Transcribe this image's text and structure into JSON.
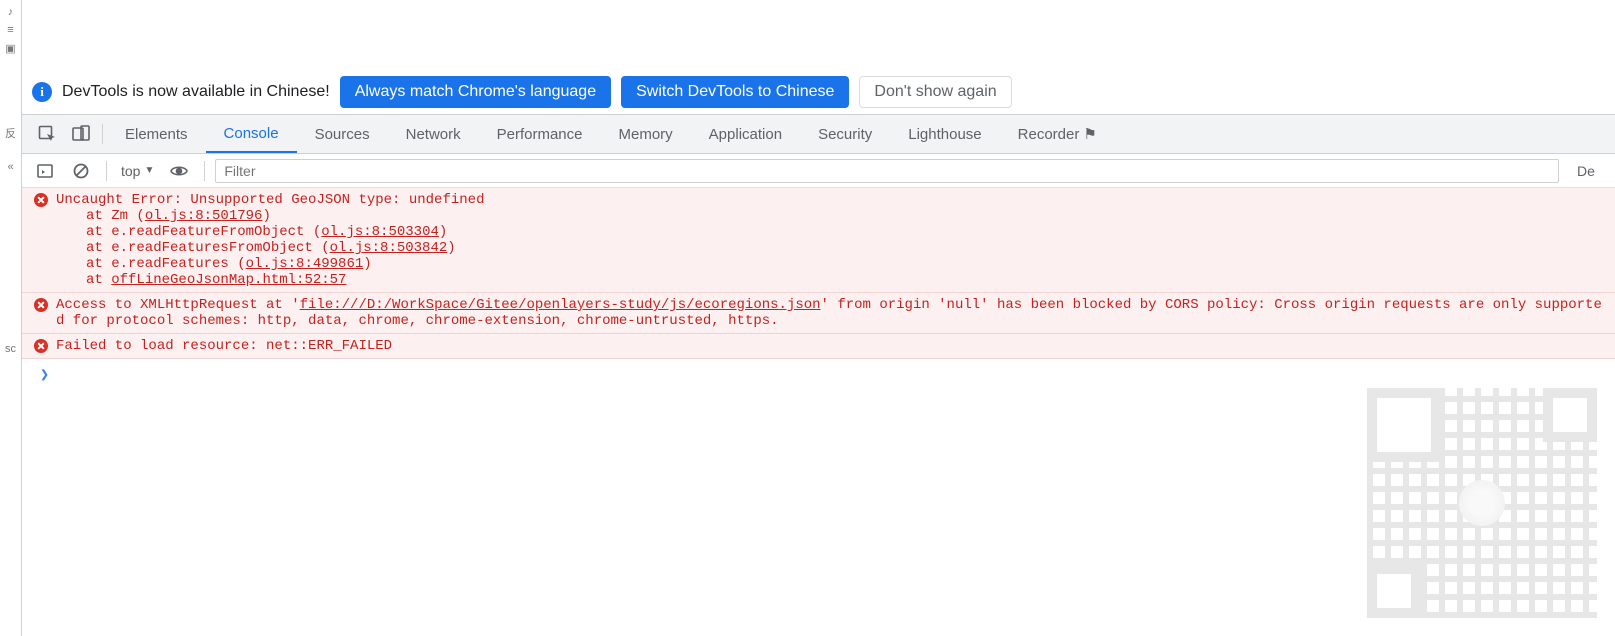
{
  "banner": {
    "text": "DevTools is now available in Chinese!",
    "always_button": "Always match Chrome's language",
    "switch_button": "Switch DevTools to Chinese",
    "dismiss_button": "Don't show again"
  },
  "tabs": {
    "items": [
      {
        "label": "Elements"
      },
      {
        "label": "Console"
      },
      {
        "label": "Sources"
      },
      {
        "label": "Network"
      },
      {
        "label": "Performance"
      },
      {
        "label": "Memory"
      },
      {
        "label": "Application"
      },
      {
        "label": "Security"
      },
      {
        "label": "Lighthouse"
      },
      {
        "label": "Recorder"
      }
    ],
    "active_index": 1
  },
  "toolbar": {
    "context_label": "top",
    "filter_placeholder": "Filter",
    "suffix_text": "De"
  },
  "console": {
    "messages": [
      {
        "type": "error",
        "text": "Uncaught Error: Unsupported GeoJSON type: undefined",
        "stack": [
          {
            "prefix": "at Zm (",
            "link": "ol.js:8:501796",
            "suffix": ")"
          },
          {
            "prefix": "at e.readFeatureFromObject (",
            "link": "ol.js:8:503304",
            "suffix": ")"
          },
          {
            "prefix": "at e.readFeaturesFromObject (",
            "link": "ol.js:8:503842",
            "suffix": ")"
          },
          {
            "prefix": "at e.readFeatures (",
            "link": "ol.js:8:499861",
            "suffix": ")"
          },
          {
            "prefix": "at ",
            "link": "offLineGeoJsonMap.html:52:57",
            "suffix": ""
          }
        ]
      },
      {
        "type": "error",
        "text_pre": "Access to XMLHttpRequest at '",
        "link": "file:///D:/WorkSpace/Gitee/openlayers-study/js/ecoregions.json",
        "text_post": "' from origin 'null' has been blocked by CORS policy: Cross origin requests are only supported for protocol schemes: http, data, chrome, chrome-extension, chrome-untrusted, https."
      },
      {
        "type": "error",
        "text": "Failed to load resource: net::ERR_FAILED"
      }
    ],
    "prompt_symbol": "❯"
  }
}
